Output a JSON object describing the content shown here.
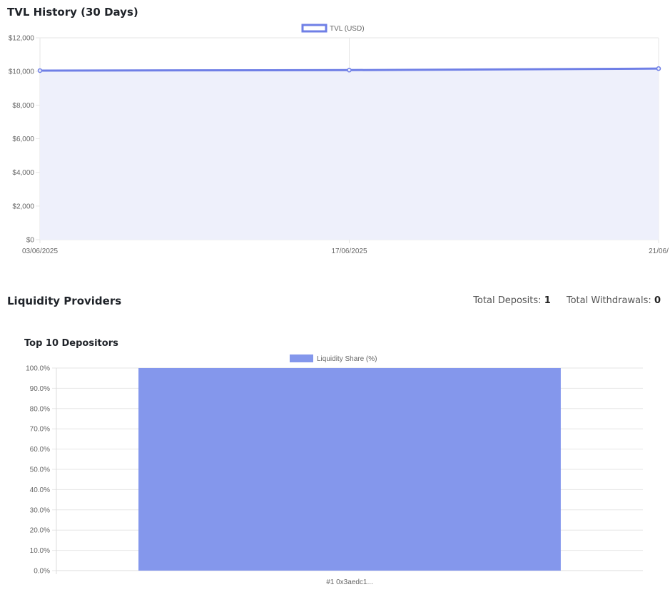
{
  "tvl_section": {
    "title": "TVL History (30 Days)"
  },
  "liquidity_section": {
    "title": "Liquidity Providers",
    "total_deposits_label": "Total Deposits:",
    "total_deposits_value": "1",
    "total_withdrawals_label": "Total Withdrawals:",
    "total_withdrawals_value": "0"
  },
  "depositors_section": {
    "title": "Top 10 Depositors"
  },
  "colors": {
    "tvl_line": "#6f7fe6",
    "tvl_fill": "#eef0fb",
    "bar_fill": "#8497ec",
    "grid": "#e6e6e6"
  },
  "chart_data": [
    {
      "type": "line",
      "fill": true,
      "x": [
        "03/06/2025",
        "17/06/2025",
        "21/06/"
      ],
      "series": [
        {
          "name": "TVL (USD)",
          "values": [
            10050,
            10080,
            10170
          ]
        }
      ],
      "y_ticks": [
        "$0",
        "$2,000",
        "$4,000",
        "$6,000",
        "$8,000",
        "$10,000",
        "$12,000"
      ],
      "ylim": [
        0,
        12000
      ],
      "legend": "top-center",
      "grid": true
    },
    {
      "type": "bar",
      "categories": [
        "#1 0x3aedc1..."
      ],
      "series": [
        {
          "name": "Liquidity Share (%)",
          "values": [
            100
          ]
        }
      ],
      "y_ticks": [
        "0.0%",
        "10.0%",
        "20.0%",
        "30.0%",
        "40.0%",
        "50.0%",
        "60.0%",
        "70.0%",
        "80.0%",
        "90.0%",
        "100.0%"
      ],
      "ylim": [
        0,
        100
      ],
      "legend": "top-center",
      "grid": true
    }
  ]
}
